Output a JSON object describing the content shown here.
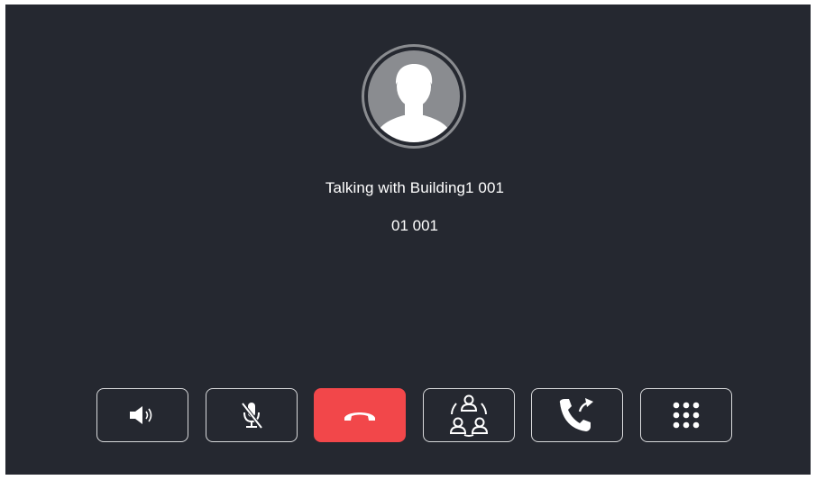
{
  "call": {
    "title": "Talking with Building1 001",
    "number": "01 001"
  },
  "avatar": {
    "icon": "person-silhouette-icon"
  },
  "controls": [
    {
      "name": "speaker",
      "icon": "speaker-icon"
    },
    {
      "name": "mute",
      "icon": "mic-off-icon"
    },
    {
      "name": "hangup",
      "icon": "hangup-icon"
    },
    {
      "name": "conference",
      "icon": "group-icon"
    },
    {
      "name": "transfer",
      "icon": "call-transfer-icon"
    },
    {
      "name": "keypad",
      "icon": "dialpad-icon"
    }
  ],
  "colors": {
    "background": "#252830",
    "hangup": "#f2474a",
    "avatar": "#8a8c90",
    "button_border": "#d8d9db",
    "text": "#ffffff"
  }
}
